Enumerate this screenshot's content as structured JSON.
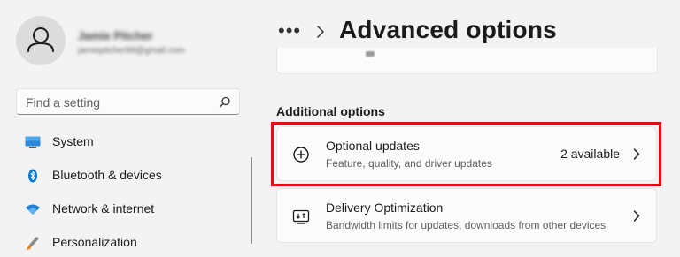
{
  "user": {
    "name": "Jamie Pitcher",
    "email": "jamiepitcher98@gmail.com"
  },
  "search": {
    "placeholder": "Find a setting"
  },
  "sidebar": {
    "items": [
      {
        "label": "System",
        "icon": "monitor-icon"
      },
      {
        "label": "Bluetooth & devices",
        "icon": "bluetooth-icon"
      },
      {
        "label": "Network & internet",
        "icon": "wifi-icon"
      },
      {
        "label": "Personalization",
        "icon": "brush-icon"
      }
    ]
  },
  "header": {
    "breadcrumb_ellipsis": "•••",
    "title": "Advanced options"
  },
  "main": {
    "section_heading": "Additional options",
    "options": [
      {
        "title": "Optional updates",
        "description": "Feature, quality, and driver updates",
        "status": "2 available",
        "icon": "plus-circle-icon"
      },
      {
        "title": "Delivery Optimization",
        "description": "Bandwidth limits for updates, downloads from other devices",
        "status": "",
        "icon": "delivery-optimization-icon"
      }
    ]
  },
  "colors": {
    "accent": "#0067c0",
    "highlight": "#e01010",
    "background": "#f3f3f3",
    "card": "#fbfbfb"
  }
}
